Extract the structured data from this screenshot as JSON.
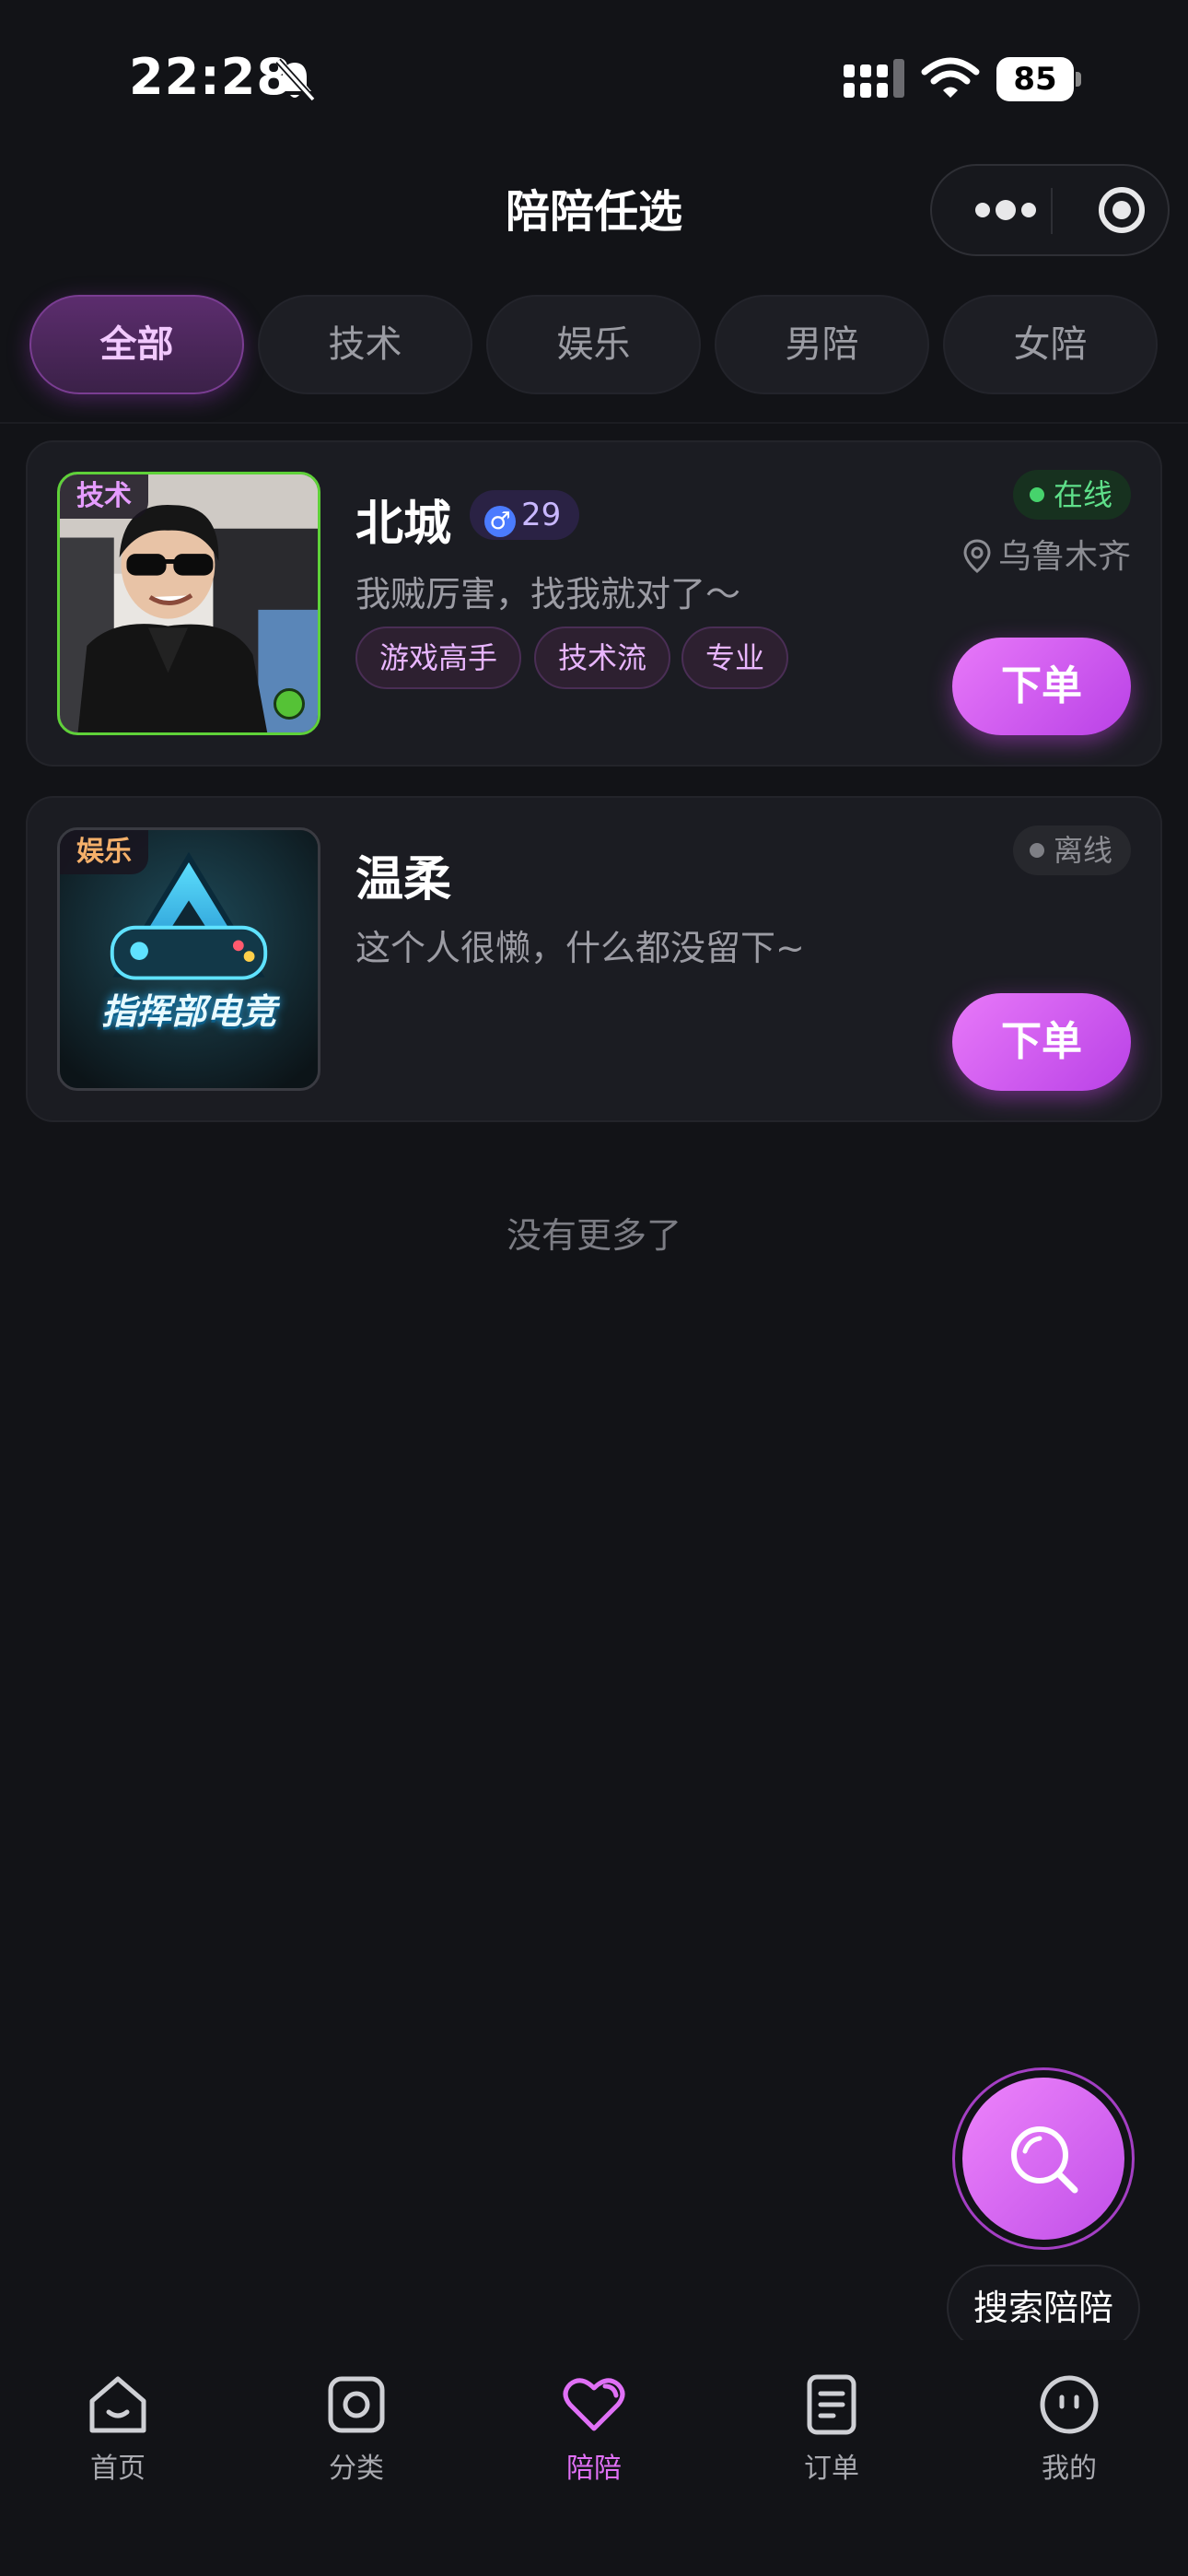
{
  "status_bar": {
    "time": "22:28",
    "battery": "85"
  },
  "nav": {
    "title": "陪陪任选"
  },
  "tabs": [
    {
      "label": "全部",
      "active": true
    },
    {
      "label": "技术",
      "active": false
    },
    {
      "label": "娱乐",
      "active": false
    },
    {
      "label": "男陪",
      "active": false
    },
    {
      "label": "女陪",
      "active": false
    }
  ],
  "cards": [
    {
      "category_tag": "技术",
      "name": "北城",
      "gender_symbol": "♂",
      "age": "29",
      "bio": "我贼厉害，找我就对了～",
      "tags": [
        "游戏高手",
        "技术流",
        "专业"
      ],
      "status": "在线",
      "location": "乌鲁木齐",
      "order_label": "下单"
    },
    {
      "category_tag": "娱乐",
      "name": "温柔",
      "bio": "这个人很懒，什么都没留下~",
      "status": "离线",
      "order_label": "下单",
      "avatar_text": "指挥部电竞"
    }
  ],
  "footer_note": "没有更多了",
  "fab": {
    "label": "搜索陪陪"
  },
  "tabbar": [
    {
      "label": "首页",
      "icon": "home-icon"
    },
    {
      "label": "分类",
      "icon": "category-icon"
    },
    {
      "label": "陪陪",
      "icon": "heart-icon",
      "active": true
    },
    {
      "label": "订单",
      "icon": "order-icon"
    },
    {
      "label": "我的",
      "icon": "profile-icon"
    }
  ],
  "colors": {
    "accent": "#d96af5",
    "online": "#46d36c",
    "background": "#121317"
  }
}
